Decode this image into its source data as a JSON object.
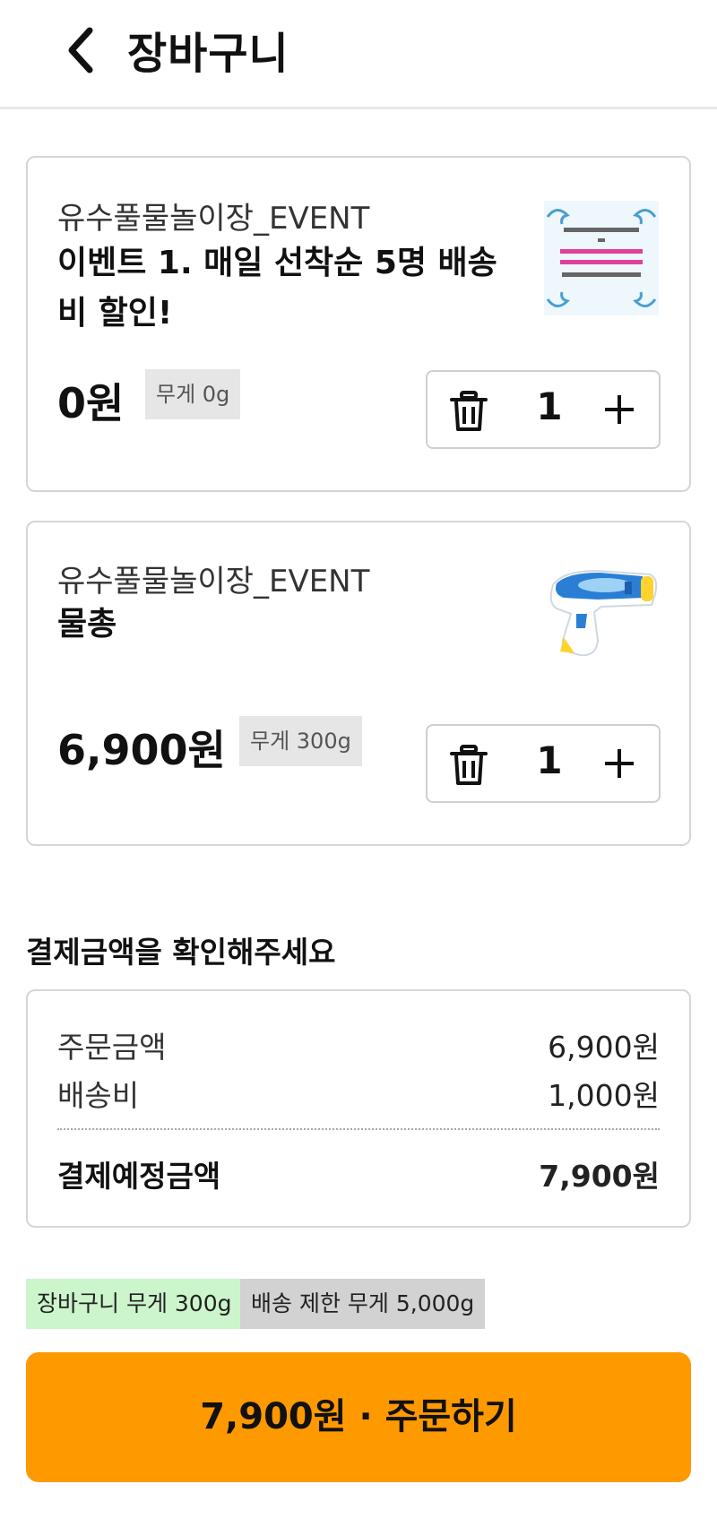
{
  "header": {
    "title": "장바구니"
  },
  "cart": {
    "items": [
      {
        "store": "유수풀물놀이장_EVENT",
        "name": "이벤트 1. 매일 선착순 5명 배송비 할인!",
        "price": "0원",
        "weight": "무게 0g",
        "quantity": "1"
      },
      {
        "store": "유수풀물놀이장_EVENT",
        "name": "물총",
        "price": "6,900원",
        "weight": "무게 300g",
        "quantity": "1"
      }
    ]
  },
  "payment": {
    "title": "결제금액을 확인해주세요",
    "order_amount_label": "주문금액",
    "order_amount": "6,900원",
    "shipping_label": "배송비",
    "shipping": "1,000원",
    "total_label": "결제예정금액",
    "total": "7,900원"
  },
  "badges": {
    "cart_weight": "장바구니 무게 300g",
    "limit_weight": "배송 제한 무게 5,000g"
  },
  "order_button": {
    "label": "7,900원 · 주문하기"
  },
  "colors": {
    "accent": "#ff9900",
    "weight_ok": "#ccf5cc"
  }
}
